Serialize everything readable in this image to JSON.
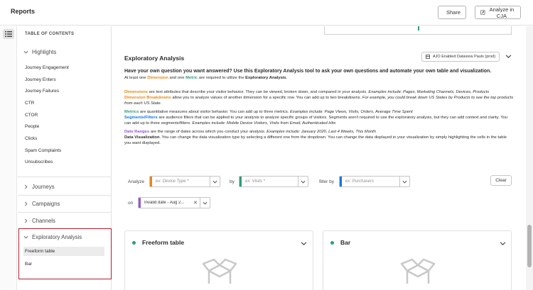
{
  "header": {
    "title": "Reports",
    "share_label": "Share",
    "analyze_label": "Analyze in CJA"
  },
  "toc": {
    "heading": "TABLE OF CONTENTS",
    "highlights": {
      "label": "Highlights",
      "items": [
        "Journey Engagement",
        "Journey Enters",
        "Journey Failures",
        "CTR",
        "CTOR",
        "People",
        "Clicks",
        "Spam Complaints",
        "Unsubscribes"
      ]
    },
    "journeys": "Journeys",
    "campaigns": "Campaigns",
    "channels": "Channels",
    "exploratory": {
      "label": "Exploratory Analysis",
      "items": [
        "Freeform table",
        "Bar"
      ]
    }
  },
  "main": {
    "title": "Exploratory Analysis",
    "dataview": "AJO Enabled Dataview Pauls (prod)",
    "question": "Have your own question you want answered? Use this Exploratory Analysis tool to ask your own questions and automate your own table and visualization.",
    "req": {
      "p1": "At least one ",
      "dimension": "Dimension",
      "p2": " and one ",
      "metric": "Metric",
      "p3": " are required to utilize the ",
      "ea": "Exploratory Analysis",
      "p4": "."
    },
    "dim": {
      "term": "Dimensions",
      "text": " are text attributes that describe your visitor behavior. They can be viewed, broken down, and compared in your analysis. ",
      "ex": "Examples include: Pages, Marketing Channels, Devices, Products"
    },
    "brk": {
      "term": "Dimension Breakdowns",
      "text": " allow you to analyze values of another dimension for a specific row. You can add up to two breakdowns. ",
      "ex": "For example, you could break down US States by Products to see the top products from each US State."
    },
    "met": {
      "term": "Metrics",
      "text": " are quantitative measures about visitor behavior. You can add up to three metrics. ",
      "ex": "Examples include: Page Views, Visits, Orders, Average Time Spent"
    },
    "seg": {
      "term": "Segments/Filters",
      "text": " are audience filters that can be applied to your analysis to analyze specific groups of visitors. Segments aren't required to use the exploratory analysis, but they can add context and clarity. You can add up to three segments/filters. ",
      "ex": "Examples include: Mobile Device Visitors, Visits from Email, Authenticated Hits"
    },
    "dr": {
      "term": "Date Ranges",
      "text": " are the range of dates across which you conduct your analysis. ",
      "ex": "Examples include: January 2020, Last 4 Weeks, This Month"
    },
    "dv": {
      "term": "Data Visualization",
      "text": ". You can change the data visualization type by selecting a different one from the dropdown. You can change the data displayed in your visualization by simply highlighting the cells in the table you want displayed."
    }
  },
  "filters": {
    "analyze_label": "Analyze",
    "analyze_ph": "ex: Device Type *",
    "by_label": "by",
    "by_ph": "ex: Visits *",
    "filterby_label": "filter by",
    "filterby_ph": "ex: Purchasers",
    "clear_label": "Clear",
    "on_label": "on",
    "date_value": "Invalid date - Aug 2..."
  },
  "cards": [
    {
      "title": "Freeform table"
    },
    {
      "title": "Bar"
    }
  ],
  "colors": {
    "dimension": "#e68619",
    "metric": "#2d9d78",
    "segment": "#1473e6",
    "daterange": "#9256d9",
    "highlight_box": "#b21e2e"
  }
}
